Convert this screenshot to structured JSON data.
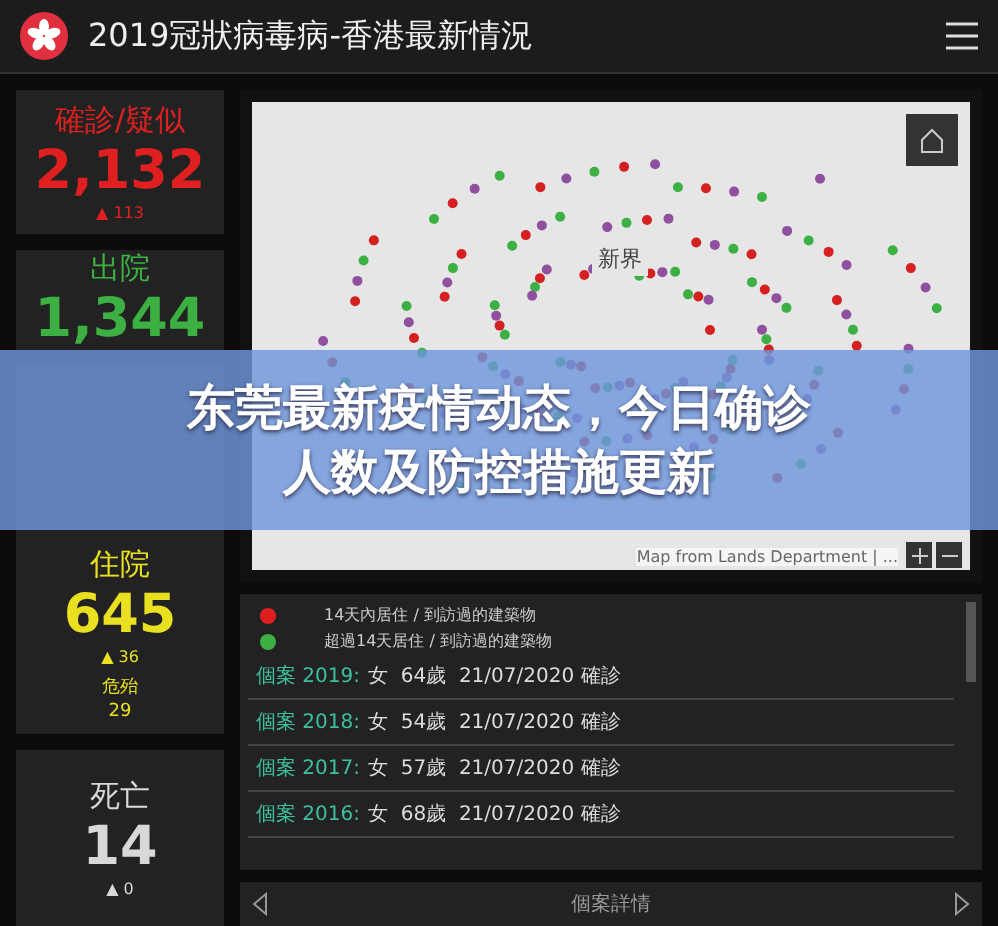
{
  "header": {
    "title": "2019冠狀病毒病-香港最新情況"
  },
  "stats": [
    {
      "label": "確診/疑似",
      "value": "2,132",
      "delta": "▲ 113",
      "color": "#e02020"
    },
    {
      "label": "出院",
      "value": "1,344",
      "color": "#3cb043"
    },
    {
      "label": "住院",
      "value": "645",
      "delta": "▲ 36",
      "sub_label": "危殆",
      "sub_value": "29",
      "color": "#e8e020"
    },
    {
      "label": "死亡",
      "value": "14",
      "delta": "▲ 0",
      "color": "#d8d8d8"
    }
  ],
  "map": {
    "place_label": "新界",
    "attribution": "Map from Lands Department | ..."
  },
  "legend": [
    {
      "color": "#e02020",
      "text": "14天內居住 / 到訪過的建築物"
    },
    {
      "color": "#3cb043",
      "text": "超過14天居住 / 到訪過的建築物"
    }
  ],
  "cases": [
    {
      "id": "個案 2019:",
      "details": "女  64歲  21/07/2020 確診"
    },
    {
      "id": "個案 2018:",
      "details": "女  54歲  21/07/2020 確診"
    },
    {
      "id": "個案 2017:",
      "details": "女  57歲  21/07/2020 確診"
    },
    {
      "id": "個案 2016:",
      "details": "女  68歲  21/07/2020 確診"
    }
  ],
  "footer": {
    "title": "個案詳情"
  },
  "banner": {
    "lines": [
      "东莞最新疫情动态，今日确诊",
      "人数及防控措施更新"
    ]
  }
}
